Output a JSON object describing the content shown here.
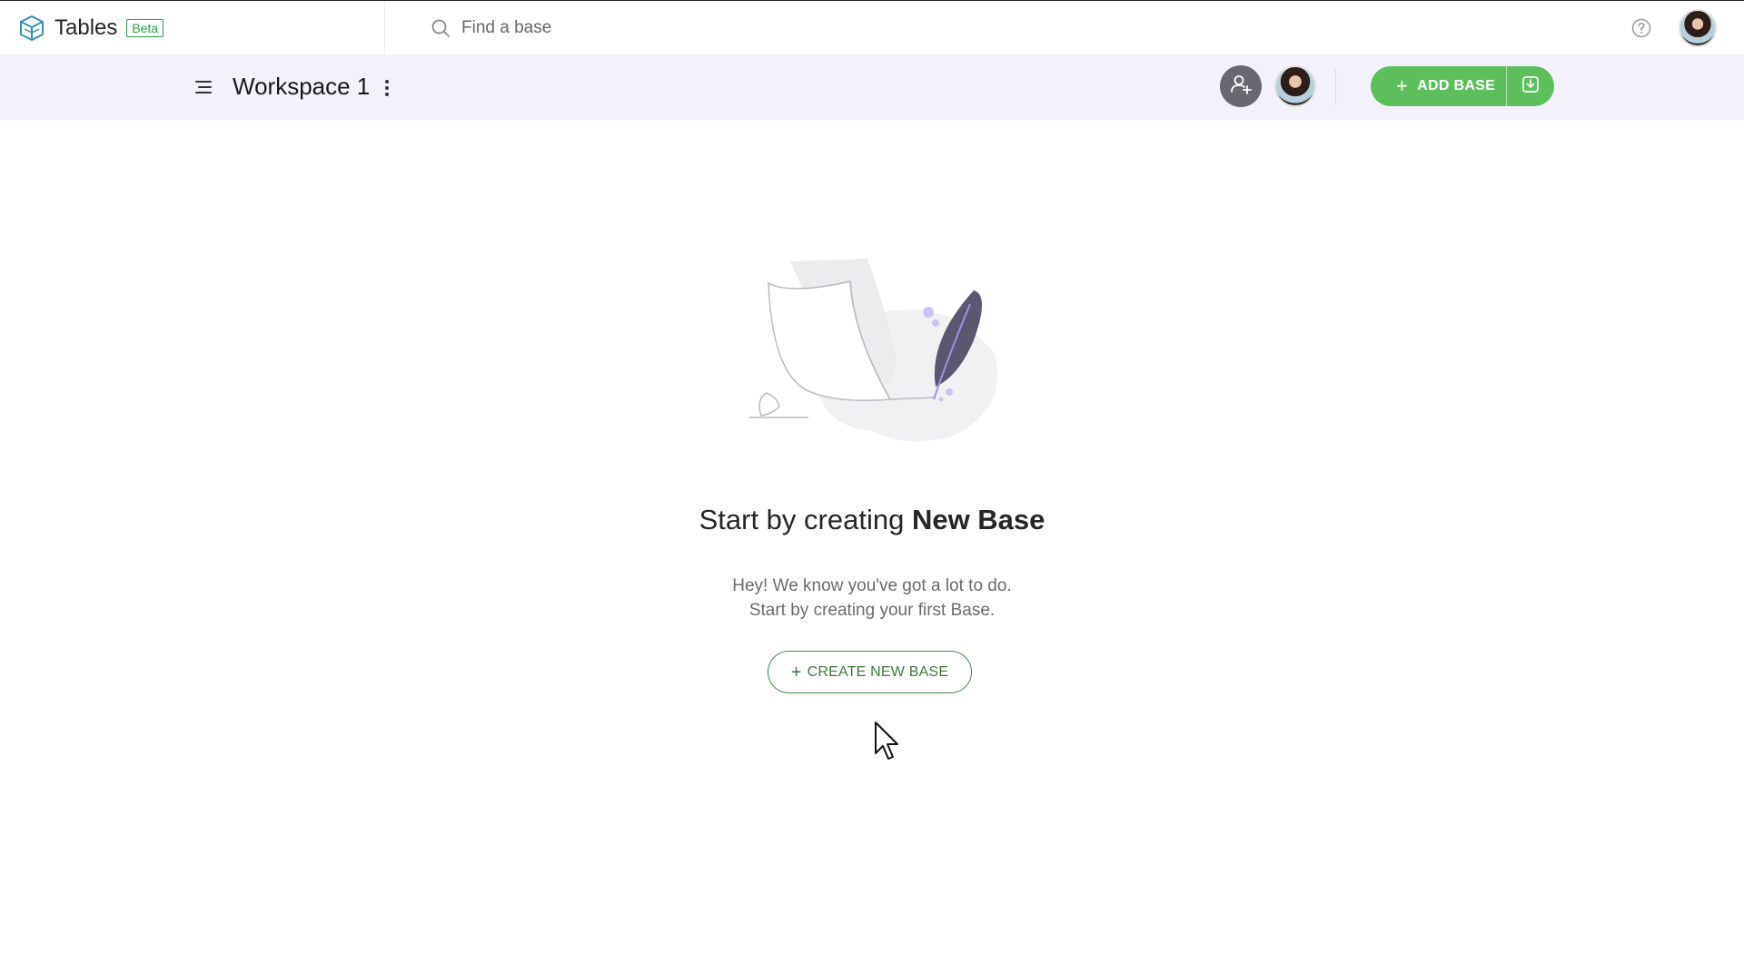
{
  "brand": {
    "name": "Tables",
    "badge": "Beta",
    "accent": "#2f9e4f"
  },
  "search": {
    "placeholder": "Find a base",
    "icon": "search-icon"
  },
  "top_right": {
    "help_icon": "help-icon",
    "profile": "avatar"
  },
  "workspace": {
    "title": "Workspace 1",
    "menu_icon": "hamburger-menu-icon",
    "more_icon": "more-vertical-icon",
    "invite_icon": "add-user-icon",
    "add_base_label": "ADD BASE",
    "add_base_color": "#5cbf5c",
    "import_icon": "import-icon",
    "background": "#f3f2fb"
  },
  "empty_state": {
    "heading_prefix": "Start by creating ",
    "heading_bold": "New Base",
    "line1": "Hey! We know you've got a lot to do.",
    "line2": "Start by creating your first Base.",
    "create_label": "CREATE NEW BASE",
    "create_plus": "+"
  }
}
